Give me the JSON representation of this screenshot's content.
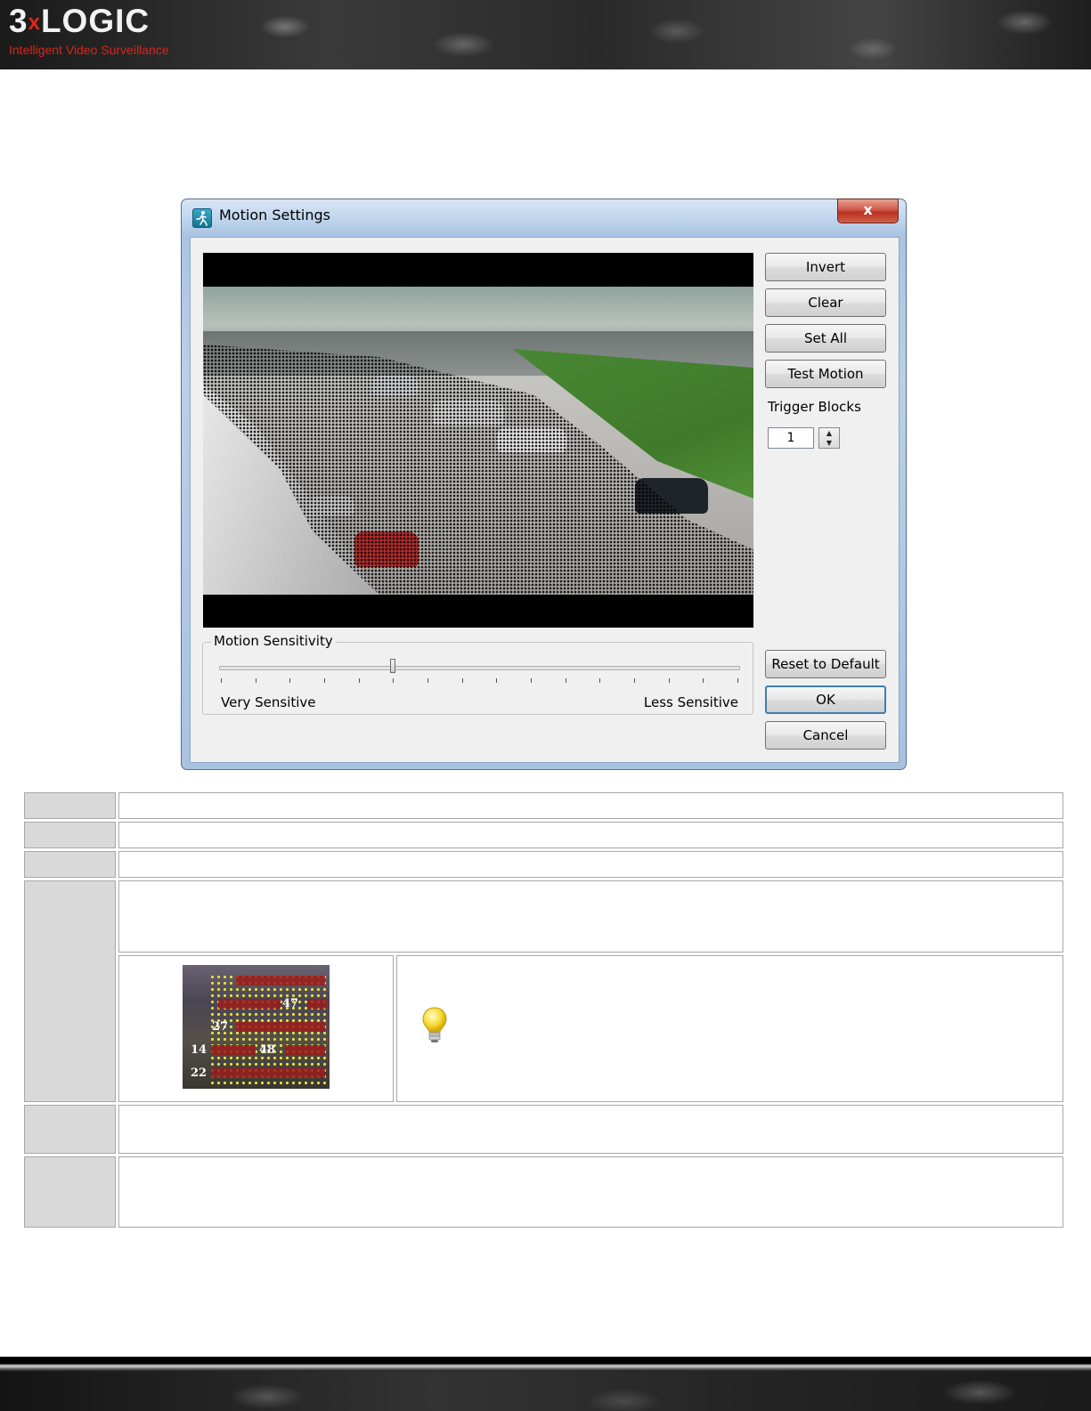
{
  "header": {
    "logo_left": "3",
    "logo_x": "x",
    "logo_right": "LOGIC",
    "tagline": "Intelligent Video Surveillance"
  },
  "dialog": {
    "title": "Motion Settings",
    "close_glyph": "x",
    "buttons": {
      "invert": "Invert",
      "clear": "Clear",
      "set_all": "Set All",
      "test_motion": "Test Motion",
      "reset_to_default": "Reset to Default",
      "ok": "OK",
      "cancel": "Cancel"
    },
    "trigger_blocks": {
      "label": "Trigger Blocks",
      "value": "1"
    },
    "motion_sensitivity": {
      "group_label": "Motion Sensitivity",
      "min_label": "Very Sensitive",
      "max_label": "Less Sensitive",
      "tick_count": 16,
      "position_index": 5
    }
  },
  "thumbnail": {
    "block_numbers": [
      "47",
      "27",
      "14",
      "48",
      "22"
    ]
  },
  "icons": {
    "window_icon": "running-man-icon",
    "tip_icon": "lightbulb-icon"
  },
  "colors": {
    "brand_red": "#d4261c",
    "close_red": "#c74435",
    "table_gray": "#d9d9d9"
  }
}
